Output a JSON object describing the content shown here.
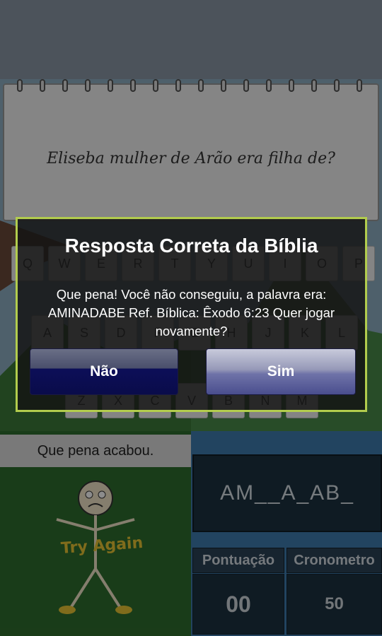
{
  "game": {
    "question": "Eliseba mulher de Arão  era filha de?",
    "keyboard": {
      "row1": [
        "Q",
        "W",
        "E",
        "R",
        "T",
        "Y",
        "U",
        "I",
        "O",
        "P"
      ],
      "row2": [
        "A",
        "S",
        "D",
        "F",
        "G",
        "H",
        "J",
        "K",
        "L"
      ],
      "row3": [
        "Z",
        "X",
        "C",
        "V",
        "B",
        "N",
        "M"
      ]
    },
    "status_message": "Que pena acabou.",
    "try_again_label": "Try Again",
    "word_progress": "AM__A_AB_",
    "score_label": "Pontuação",
    "score_value": "00",
    "timer_label": "Cronometro",
    "timer_value": "50"
  },
  "dialog": {
    "title": "Resposta Correta da Bíblia",
    "message": "Que pena! Você não conseguiu, a palavra era: AMINADABE Ref. Bíblica: Êxodo 6:23 Quer jogar novamente?",
    "no_label": "Não",
    "yes_label": "Sim"
  },
  "colors": {
    "dialog_border": "#b2cc4d",
    "word_text": "#d8e0e6",
    "try_again": "#e9c533"
  },
  "icons": [
    "stickman-sad-icon"
  ]
}
